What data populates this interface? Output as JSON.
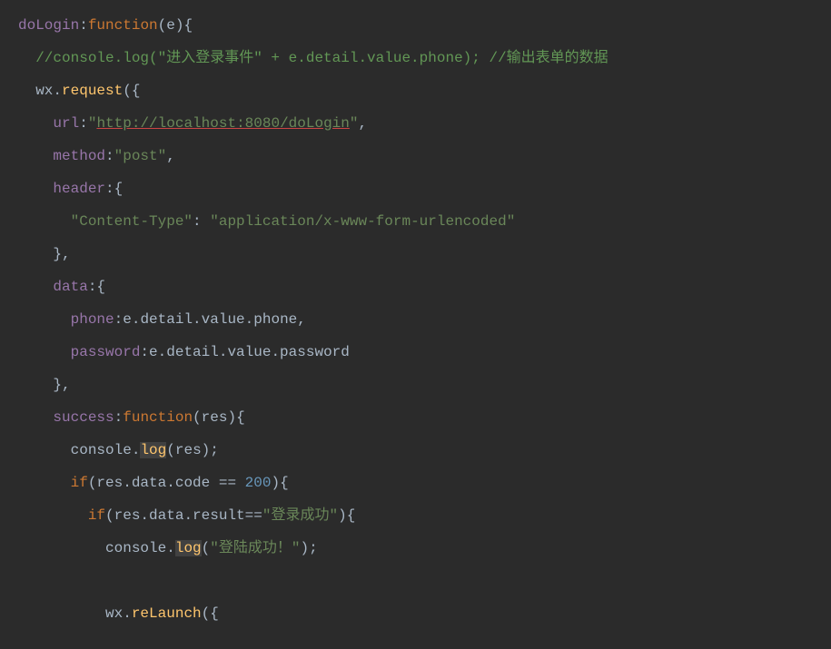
{
  "tokens": {
    "line1": {
      "doLogin": "doLogin",
      "colon1": ":",
      "function": "function",
      "lparen": "(",
      "e": "e",
      "rparen": ")",
      "lbrace": "{"
    },
    "line2": {
      "comment": "//console.log(\"进入登录事件\" + e.detail.value.phone); //输出表单的数据"
    },
    "line3": {
      "wx": "wx",
      "dot": ".",
      "request": "request",
      "lparen": "(",
      "lbrace": "{"
    },
    "line4": {
      "url": "url",
      "colon": ":",
      "quote1": "\"",
      "urlval": "http://localhost:8080/doLogin",
      "quote2": "\"",
      "comma": ","
    },
    "line5": {
      "method": "method",
      "colon": ":",
      "val": "\"post\"",
      "comma": ","
    },
    "line6": {
      "header": "header",
      "colon": ":",
      "lbrace": "{"
    },
    "line7": {
      "key": "\"Content-Type\"",
      "colon": ": ",
      "val": "\"application/x-www-form-urlencoded\""
    },
    "line8": {
      "rbrace": "}",
      "comma": ","
    },
    "line9": {
      "data": "data",
      "colon": ":",
      "lbrace": "{"
    },
    "line10": {
      "phone": "phone",
      "colon": ":",
      "expr": "e.detail.value.phone",
      "comma": ","
    },
    "line11": {
      "password": "password",
      "colon": ":",
      "expr": "e.detail.value.password"
    },
    "line12": {
      "rbrace": "}",
      "comma": ","
    },
    "line13": {
      "success": "success",
      "colon": ":",
      "function": "function",
      "lparen": "(",
      "res": "res",
      "rparen": ")",
      "lbrace": "{"
    },
    "line14": {
      "console": "console",
      "dot": ".",
      "log": "log",
      "lparen": "(",
      "res": "res",
      "rparen": ")",
      "semi": ";"
    },
    "line15": {
      "if": "if",
      "lparen": "(",
      "expr": "res.data.code == ",
      "num": "200",
      "rparen": ")",
      "lbrace": "{"
    },
    "line16": {
      "if": "if",
      "lparen": "(",
      "expr": "res.data.result==",
      "str": "\"登录成功\"",
      "rparen": ")",
      "lbrace": "{"
    },
    "line17": {
      "console": "console",
      "dot": ".",
      "log": "log",
      "lparen": "(",
      "str": "\"登陆成功！\"",
      "rparen": ")",
      "semi": ";"
    },
    "line18": {
      "wx": "wx",
      "dot": ".",
      "reLaunch": "reLaunch",
      "lparen": "(",
      "lbrace": "{"
    }
  }
}
